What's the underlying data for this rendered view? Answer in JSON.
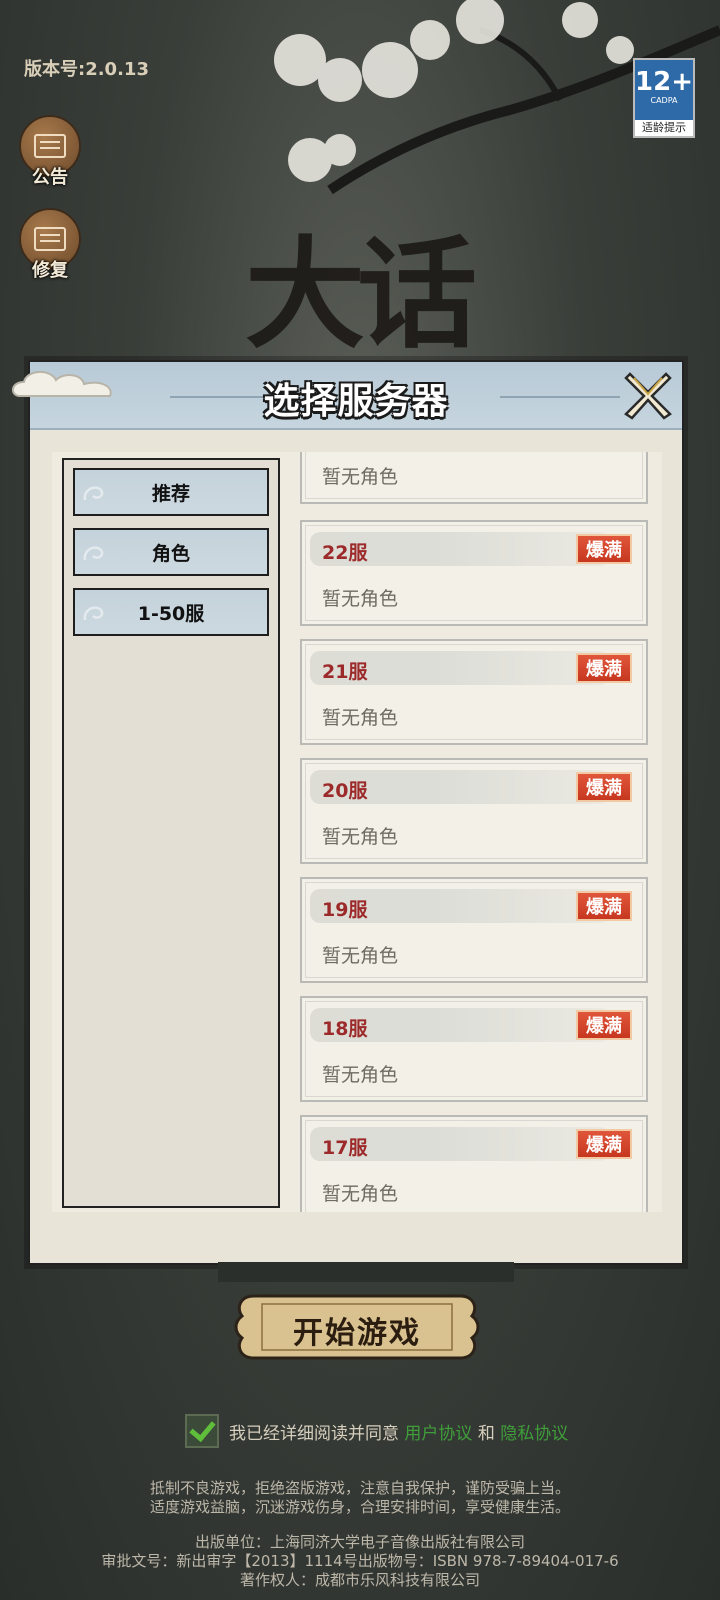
{
  "version_label": "版本号:2.0.13",
  "logo_text": "大话",
  "side_buttons": [
    {
      "label": "公告",
      "icon": "notice-board-icon"
    },
    {
      "label": "修复",
      "icon": "repair-board-icon"
    }
  ],
  "age_rating": {
    "big": "12+",
    "small": "CADPA",
    "tip": "适龄提示"
  },
  "modal": {
    "title": "选择服务器",
    "tabs": [
      {
        "label": "推荐"
      },
      {
        "label": "角色"
      },
      {
        "label": "1-50服"
      }
    ],
    "first_card_role": "暂无角色",
    "servers": [
      {
        "name": "22服",
        "status": "爆满",
        "role": "暂无角色"
      },
      {
        "name": "21服",
        "status": "爆满",
        "role": "暂无角色"
      },
      {
        "name": "20服",
        "status": "爆满",
        "role": "暂无角色"
      },
      {
        "name": "19服",
        "status": "爆满",
        "role": "暂无角色"
      },
      {
        "name": "18服",
        "status": "爆满",
        "role": "暂无角色"
      },
      {
        "name": "17服",
        "status": "爆满",
        "role": "暂无角色"
      }
    ]
  },
  "start_button": "开始游戏",
  "agreement": {
    "prefix": "我已经详细阅读并同意",
    "user_agreement": "用户协议",
    "and": "和",
    "privacy_policy": "隐私协议"
  },
  "footer": {
    "notice_line1": "抵制不良游戏，拒绝盗版游戏，注意自我保护，谨防受骗上当。",
    "notice_line2": "适度游戏益脑，沉迷游戏伤身，合理安排时间，享受健康生活。",
    "publisher": "出版单位：上海同济大学电子音像出版社有限公司",
    "approval": "审批文号：新出审字【2013】1114号出版物号：ISBN 978-7-89404-017-6",
    "copyright": "著作权人：成都市乐风科技有限公司"
  },
  "colors": {
    "server_name": "#9c2a2a",
    "full_badge": "#d2452b",
    "header_bg": "#c0d0da",
    "link": "#3f9e3a"
  }
}
